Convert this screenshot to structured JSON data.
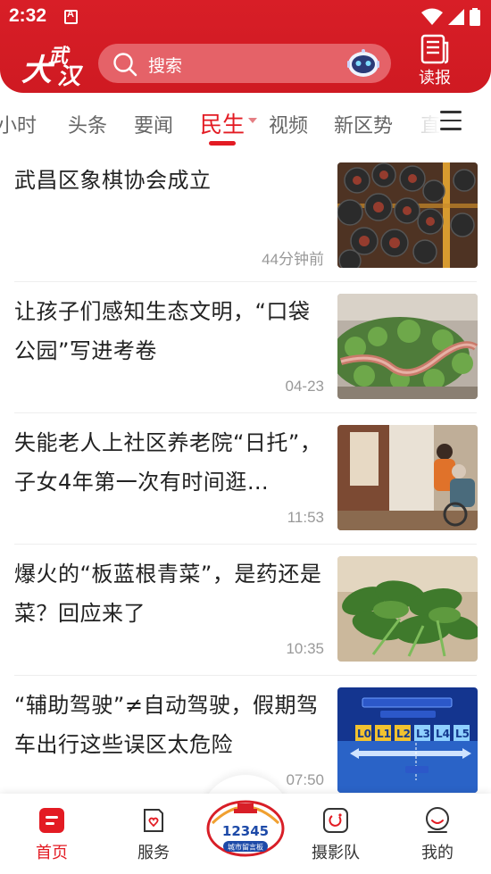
{
  "status_bar": {
    "time": "2:32"
  },
  "header": {
    "logo_text": "大武汉",
    "search": {
      "placeholder": "搜索"
    },
    "read_paper_label": "读报"
  },
  "tabs": [
    {
      "label": "小时",
      "active": false
    },
    {
      "label": "头条",
      "active": false
    },
    {
      "label": "要闻",
      "active": false
    },
    {
      "label": "民生",
      "active": true
    },
    {
      "label": "视频",
      "active": false
    },
    {
      "label": "新区势",
      "active": false
    },
    {
      "label": "直",
      "active": false
    }
  ],
  "news": [
    {
      "title": "武昌区象棋协会成立",
      "time": "44分钟前",
      "thumb": "chess-pieces"
    },
    {
      "title": "让孩子们感知生态文明，“口袋公园”写进考卷",
      "time": "04-23",
      "thumb": "pocket-park-model"
    },
    {
      "title": "失能老人上社区养老院“日托”，子女4年第一次有时间逛…",
      "time": "11:53",
      "thumb": "elderly-care"
    },
    {
      "title": "爆火的“板蓝根青菜”，是药还是菜？回应来了",
      "time": "10:35",
      "thumb": "green-vegetables"
    },
    {
      "title": "“辅助驾驶”≠自动驾驶，假期驾车出行这些误区太危险",
      "time": "07:50",
      "thumb": "driving-levels"
    }
  ],
  "bottom_nav": {
    "items": [
      {
        "label": "首页",
        "active": true
      },
      {
        "label": "服务",
        "active": false
      },
      {
        "label": "摄影队",
        "active": false
      },
      {
        "label": "我的",
        "active": false
      }
    ],
    "hotline": {
      "number": "12345",
      "caption": "城市留言板"
    }
  },
  "colors": {
    "brand_red": "#d81e27",
    "active_red": "#e31b23",
    "muted_text": "#999999"
  }
}
